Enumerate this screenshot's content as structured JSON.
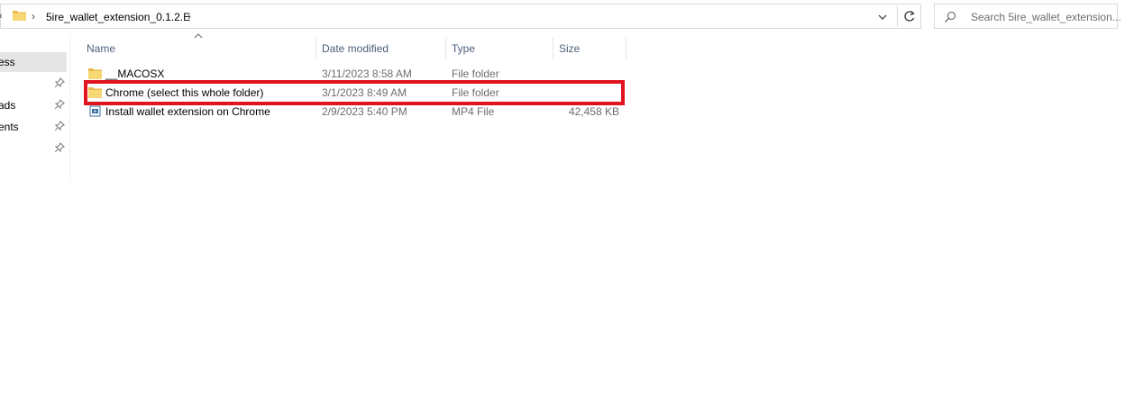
{
  "address_bar": {
    "crumb": "5ire_wallet_extension_0.1.2.E"
  },
  "search": {
    "placeholder": "Search 5ire_wallet_extension..."
  },
  "nav": {
    "items": [
      {
        "label": "ess",
        "selected": true
      },
      {
        "label": "",
        "pinned": true
      },
      {
        "label": "ads",
        "pinned": true
      },
      {
        "label": "ents",
        "pinned": true
      },
      {
        "label": "",
        "pinned": true
      }
    ]
  },
  "columns": {
    "name": "Name",
    "date": "Date modified",
    "type": "Type",
    "size": "Size"
  },
  "files": [
    {
      "name": "__MACOSX",
      "date": "3/11/2023 8:58 AM",
      "type": "File folder",
      "size": "",
      "icon": "folder-icon"
    },
    {
      "name": "Chrome (select this whole folder)",
      "date": "3/1/2023 8:49 AM",
      "type": "File folder",
      "size": "",
      "icon": "folder-icon"
    },
    {
      "name": "Install wallet extension on Chrome",
      "date": "2/9/2023 5:40 PM",
      "type": "MP4 File",
      "size": "42,458 KB",
      "icon": "video-file-icon"
    }
  ],
  "colors": {
    "highlight": "#e0131f",
    "header_text": "#4c607a",
    "folder": "#f8d775"
  }
}
